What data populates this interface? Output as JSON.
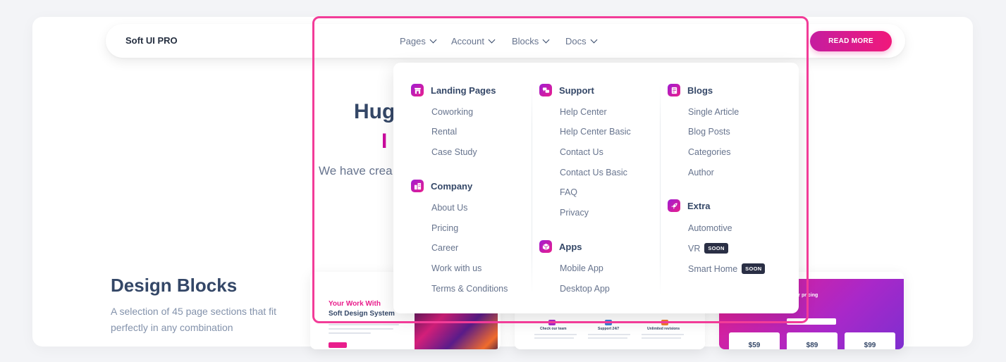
{
  "navbar": {
    "brand": "Soft UI PRO",
    "items": [
      {
        "label": "Pages"
      },
      {
        "label": "Account"
      },
      {
        "label": "Blocks"
      },
      {
        "label": "Docs"
      }
    ],
    "cta_label": "READ MORE"
  },
  "hero": {
    "title_fragment": "Hug",
    "title_fragment_2": "I",
    "subtitle_fragment": "We have crea"
  },
  "design_blocks": {
    "title": "Design Blocks",
    "description": "A selection of 45 page sections that fit perfectly in any combination",
    "thumbs": {
      "t1_heading": "Your Work With",
      "t1_heading2": "Soft Design System",
      "t2_labels": [
        "Check our team",
        "Support 24/7",
        "Unlimited revisions"
      ],
      "t3_title": "ur pricing",
      "t3_prices": [
        "$59",
        "$89",
        "$99"
      ]
    }
  },
  "dropdown": {
    "columns": [
      {
        "sections": [
          {
            "title": "Landing Pages",
            "icon": "store-icon",
            "links": [
              "Coworking",
              "Rental",
              "Case Study"
            ]
          },
          {
            "title": "Company",
            "icon": "building-icon",
            "links": [
              "About Us",
              "Pricing",
              "Career",
              "Work with us",
              "Terms & Conditions"
            ]
          }
        ]
      },
      {
        "sections": [
          {
            "title": "Support",
            "icon": "chat-icon",
            "links": [
              "Help Center",
              "Help Center Basic",
              "Contact Us",
              "Contact Us Basic",
              "FAQ",
              "Privacy"
            ]
          },
          {
            "title": "Apps",
            "icon": "box-icon",
            "links": [
              "Mobile App",
              "Desktop App"
            ]
          }
        ]
      },
      {
        "sections": [
          {
            "title": "Blogs",
            "icon": "document-icon",
            "links": [
              "Single Article",
              "Blog Posts",
              "Categories",
              "Author"
            ]
          },
          {
            "title": "Extra",
            "icon": "rocket-icon",
            "links": [
              "Automotive",
              "VR",
              "Smart Home"
            ],
            "badges": {
              "1": "SOON",
              "2": "SOON"
            }
          }
        ]
      }
    ]
  },
  "colors": {
    "accent": "#cb0c9f",
    "highlight": "#f23c98",
    "text_dark": "#344767",
    "text_muted": "#67748e"
  }
}
